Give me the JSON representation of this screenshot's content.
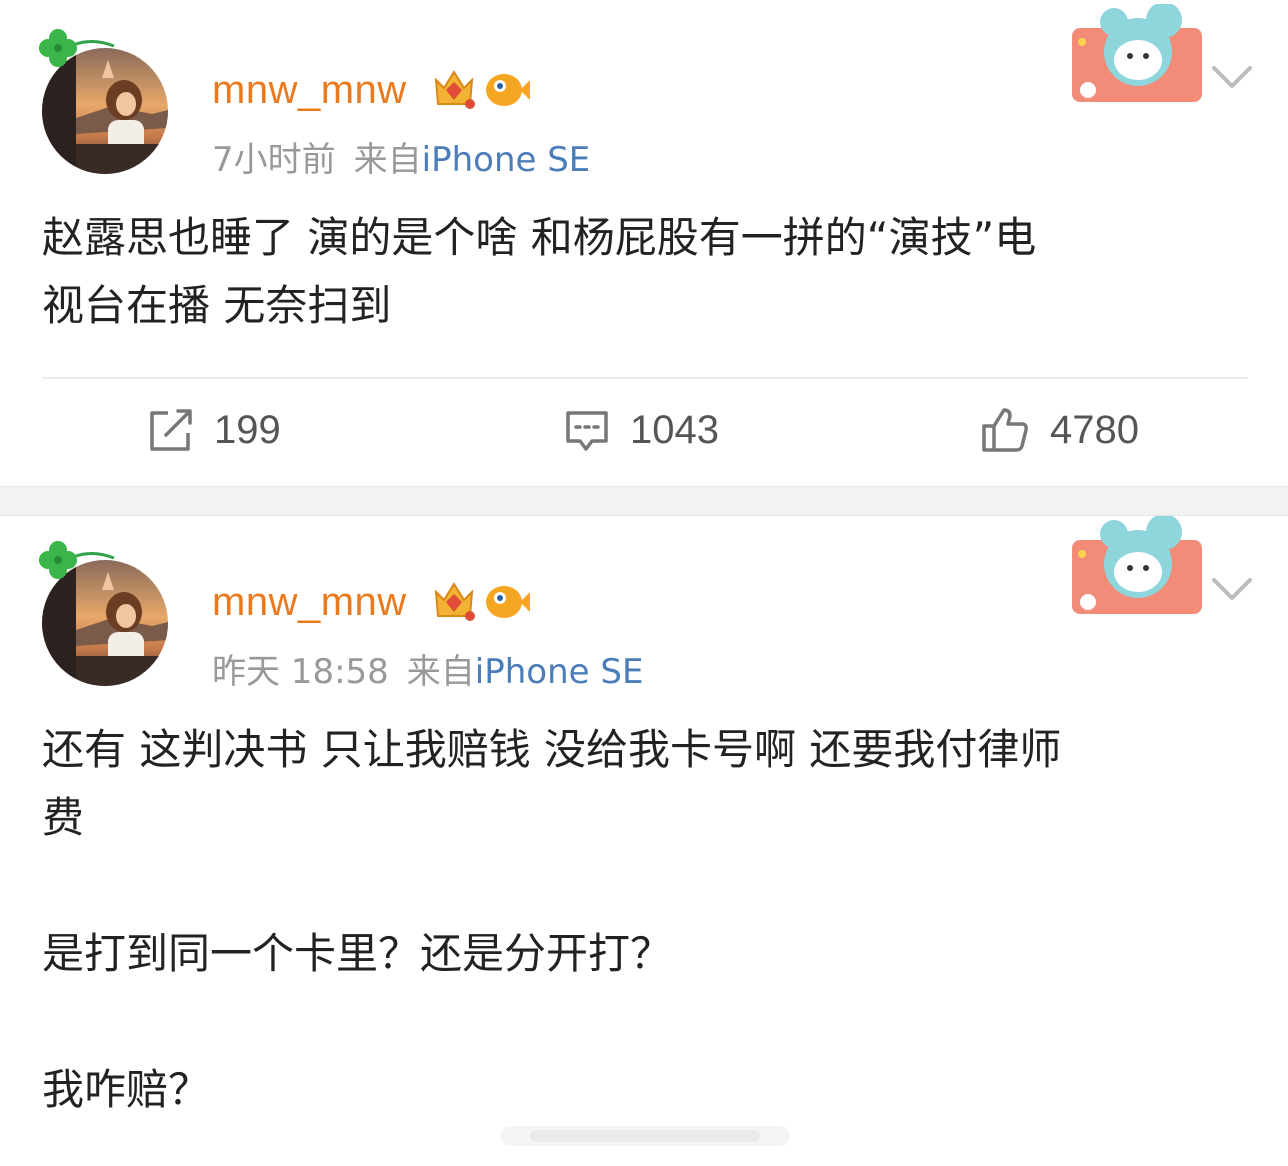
{
  "posts": [
    {
      "username": "mnw_mnw",
      "time": "7小时前",
      "source_prefix": "来自",
      "device": "iPhone SE",
      "content_lines": [
        "赵露思也睡了 演的是个啥 和杨屁股有一拼的“演技”电",
        "视台在播 无奈扫到"
      ],
      "actions": {
        "repost_count": "199",
        "comment_count": "1043",
        "like_count": "4780"
      }
    },
    {
      "username": "mnw_mnw",
      "time": "昨天 18:58",
      "source_prefix": "来自",
      "device": "iPhone SE",
      "content_lines": [
        "还有 这判决书 只让我赔钱 没给我卡号啊 还要我付律师",
        "费",
        "",
        "是打到同一个卡里？还是分开打？",
        "",
        "我咋赔？"
      ]
    }
  ],
  "icons": {
    "repost": "repost-icon",
    "comment": "comment-icon",
    "like": "thumbs-up-icon",
    "menu": "chevron-down-icon",
    "crown_badge": "crown-badge-icon",
    "fish_badge": "fish-badge-icon"
  },
  "colors": {
    "username": "#eb7a1e",
    "device": "#4b7db8",
    "meta": "#999999",
    "text": "#222222"
  }
}
